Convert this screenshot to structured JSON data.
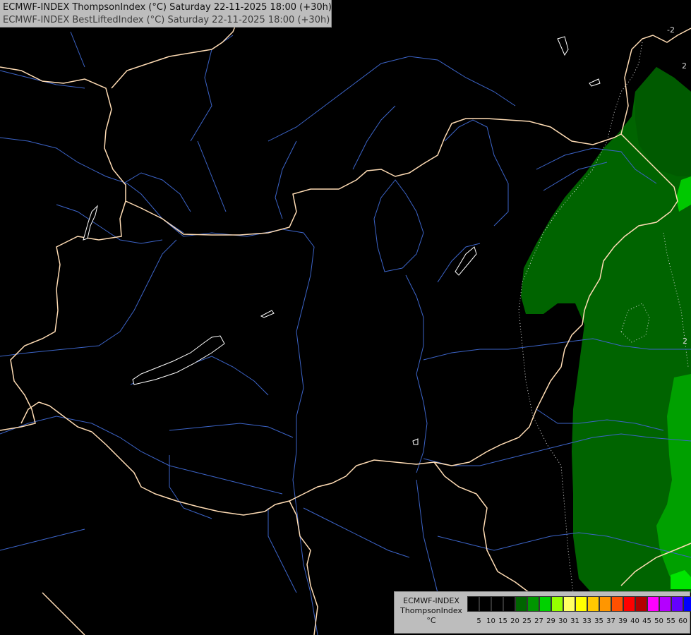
{
  "header": {
    "line1": "ECMWF-INDEX ThompsonIndex (°C) Saturday 22-11-2025 18:00 (+30h)",
    "line2": "ECMWF-INDEX BestLiftedIndex (°C) Saturday 22-11-2025 18:00 (+30h)"
  },
  "map": {
    "contour_labels": [
      "-2",
      "2",
      "2"
    ]
  },
  "legend": {
    "model": "ECMWF-INDEX",
    "variable": "ThompsonIndex",
    "unit": "°C",
    "levels": [
      "5",
      "10",
      "15",
      "20",
      "25",
      "27",
      "29",
      "30",
      "31",
      "33",
      "35",
      "37",
      "39",
      "40",
      "45",
      "50",
      "55",
      "60"
    ],
    "colors": [
      "#000000",
      "#000000",
      "#000000",
      "#000000",
      "#006400",
      "#009600",
      "#00d200",
      "#96ff00",
      "#ffff64",
      "#ffff00",
      "#ffc800",
      "#ff9600",
      "#ff5000",
      "#ff0000",
      "#b40000",
      "#ff00ff",
      "#b400ff",
      "#6400ff",
      "#0000ff"
    ]
  },
  "colors": {
    "background": "#000000",
    "border": "#ffdcb4",
    "river": "#3c64c8",
    "green_dark": "#006400",
    "green_mid": "#008c00",
    "green_light": "#00c800",
    "lake": "#ffffff"
  }
}
